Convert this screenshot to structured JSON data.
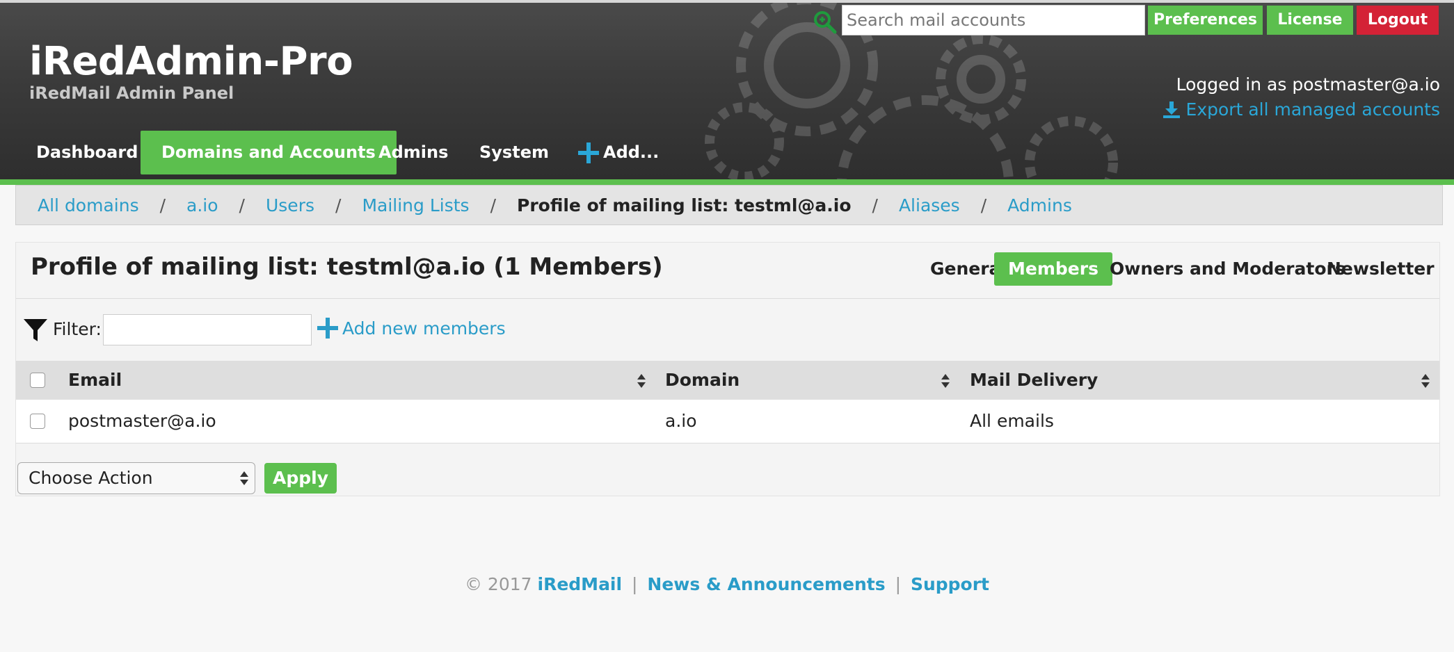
{
  "header": {
    "brand_title": "iRedAdmin-Pro",
    "brand_subtitle": "iRedMail Admin Panel",
    "search_placeholder": "Search mail accounts",
    "buttons": {
      "preferences": "Preferences",
      "license": "License",
      "logout": "Logout"
    },
    "logged_in_text": "Logged in as postmaster@a.io",
    "export_link": "Export all managed accounts",
    "nav": {
      "dashboard": "Dashboard",
      "domains": "Domains and Accounts",
      "admins": "Admins",
      "system": "System",
      "add": "Add..."
    }
  },
  "breadcrumb": {
    "all_domains": "All domains",
    "domain": "a.io",
    "users": "Users",
    "mailing_lists": "Mailing Lists",
    "current": "Profile of mailing list: testml@a.io",
    "aliases": "Aliases",
    "admins": "Admins",
    "separator": "/"
  },
  "panel": {
    "title": "Profile of mailing list: testml@a.io (1 Members)",
    "tabs": {
      "general": "General",
      "members": "Members",
      "owners": "Owners and Moderators",
      "newsletter": "Newsletter"
    },
    "filter_label": "Filter:",
    "add_members": "Add new members",
    "columns": {
      "email": "Email",
      "domain": "Domain",
      "delivery": "Mail Delivery"
    },
    "rows": [
      {
        "email": "postmaster@a.io",
        "domain": "a.io",
        "delivery": "All emails"
      }
    ],
    "action_select": "Choose Action",
    "apply": "Apply"
  },
  "footer": {
    "copyright": "© 2017",
    "iredmail": "iRedMail",
    "news": "News & Announcements",
    "support": "Support",
    "pipe": "|"
  },
  "colors": {
    "accent_green": "#5cbf4e",
    "logout_red": "#d42236",
    "link_blue": "#2a9cc8",
    "header_dark": "#3c3c3c"
  },
  "icons": [
    "search-icon",
    "download-icon",
    "plus-icon",
    "filter-icon",
    "sort-icon"
  ]
}
